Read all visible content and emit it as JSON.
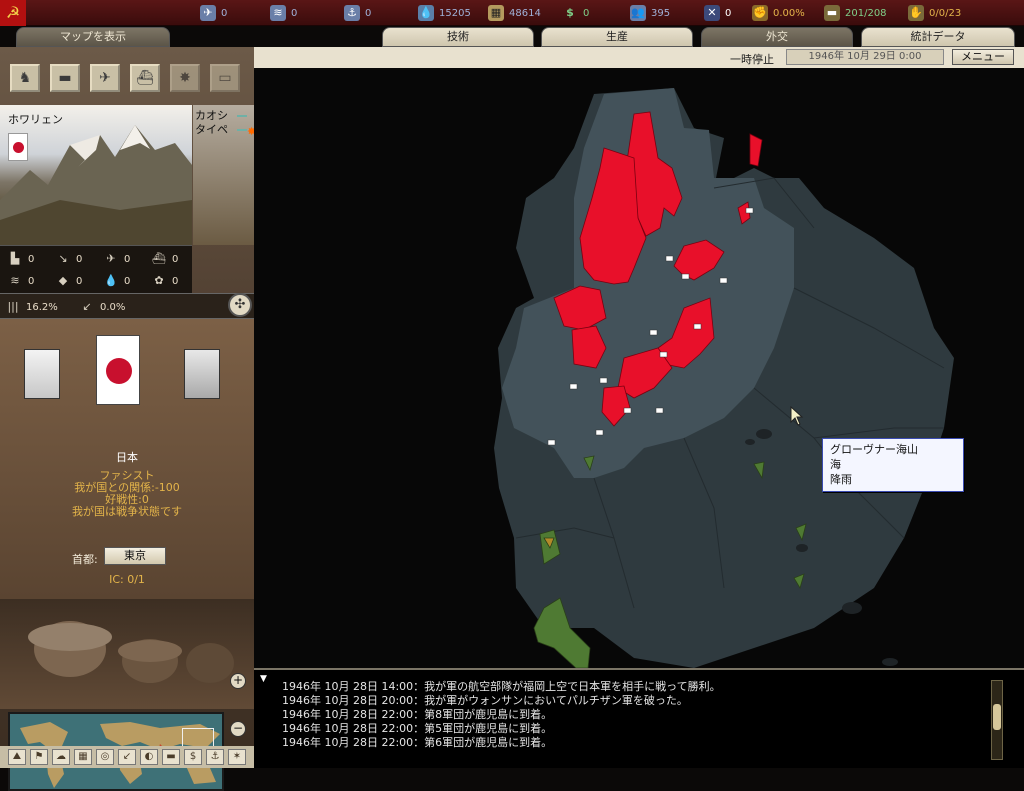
{
  "top_bar": {
    "resources": [
      {
        "name": "transport-icon",
        "value": "0",
        "color": "#9fb1d8"
      },
      {
        "name": "convoy-icon",
        "value": "0",
        "color": "#9fb1d8"
      },
      {
        "name": "escort-icon",
        "value": "0",
        "color": "#9fb1d8"
      },
      {
        "name": "oil-icon",
        "value": "15205",
        "color": "#9fb1d8"
      },
      {
        "name": "supplies-icon",
        "value": "48614",
        "color": "#9fb1d8"
      },
      {
        "name": "money-icon",
        "value": "0",
        "color": "#9fb1d8"
      },
      {
        "name": "manpower-icon",
        "value": "395",
        "color": "#9fb1d8"
      },
      {
        "name": "crossed-swords-icon",
        "value": "0",
        "color": "#ffffff"
      },
      {
        "name": "dissent-icon",
        "value": "0.00%",
        "color": "#e3b44a"
      },
      {
        "name": "tank-icon",
        "value": "201/208",
        "color": "#7fd089"
      },
      {
        "name": "division-icon",
        "value": "0/0/23",
        "color": "#e3b44a"
      }
    ]
  },
  "tabs": [
    {
      "label": "マップを表示",
      "active": true
    },
    {
      "label": "技術",
      "active": false
    },
    {
      "label": "生産",
      "active": false
    },
    {
      "label": "外交",
      "active": true
    },
    {
      "label": "統計データ",
      "active": false
    }
  ],
  "status": {
    "pause_label": "一時停止",
    "date": "1946年 10月 29日 0:00",
    "menu_label": "メニュー"
  },
  "province": {
    "name": "ホワリェン",
    "unit_count": "0",
    "neighbors": [
      {
        "name": "カオシ"
      },
      {
        "name": "タイペ"
      }
    ],
    "stats": [
      {
        "icon": "factory-icon",
        "value": "0"
      },
      {
        "icon": "flak-icon",
        "value": "0"
      },
      {
        "icon": "air-base-icon",
        "value": "0"
      },
      {
        "icon": "naval-base-icon",
        "value": "0"
      },
      {
        "icon": "metal-icon",
        "value": "0"
      },
      {
        "icon": "energy-icon",
        "value": "0"
      },
      {
        "icon": "oil-drop-icon",
        "value": "0"
      },
      {
        "icon": "rare-materials-icon",
        "value": "0"
      }
    ],
    "rates": [
      {
        "icon": "manpower-bar-icon",
        "value": "16.2%"
      },
      {
        "icon": "resistance-icon",
        "value": "0.0%"
      }
    ]
  },
  "diplomacy": {
    "country": "日本",
    "ideology": "ファシスト",
    "relations": "我が国との関係:-100",
    "affinity": "好戦性:0",
    "war_status": "我が国は戦争状態です",
    "capital_label": "首都:",
    "capital_value": "東京",
    "ic": "IC: 0/1"
  },
  "tooltip": {
    "line1": "グローヴナー海山",
    "line2": "海",
    "line3": "降雨"
  },
  "log": [
    "1946年 10月 28日 14:00：我が軍の航空部隊が福岡上空で日本軍を相手に戦って勝利。",
    "1946年 10月 28日 20:00：我が軍がウォンサンにおいてパルチザン軍を破った。",
    "1946年 10月 28日 22:00：第8軍団が鹿児島に到着。",
    "1946年 10月 28日 22:00：第5軍団が鹿児島に到着。",
    "1946年 10月 28日 22:00：第6軍団が鹿児島に到着。"
  ],
  "colors": {
    "enemy_territory": "#e8102a",
    "sea": "#43525a",
    "allied_land": "#4f7a33",
    "accent_gold": "#e3b44a"
  }
}
